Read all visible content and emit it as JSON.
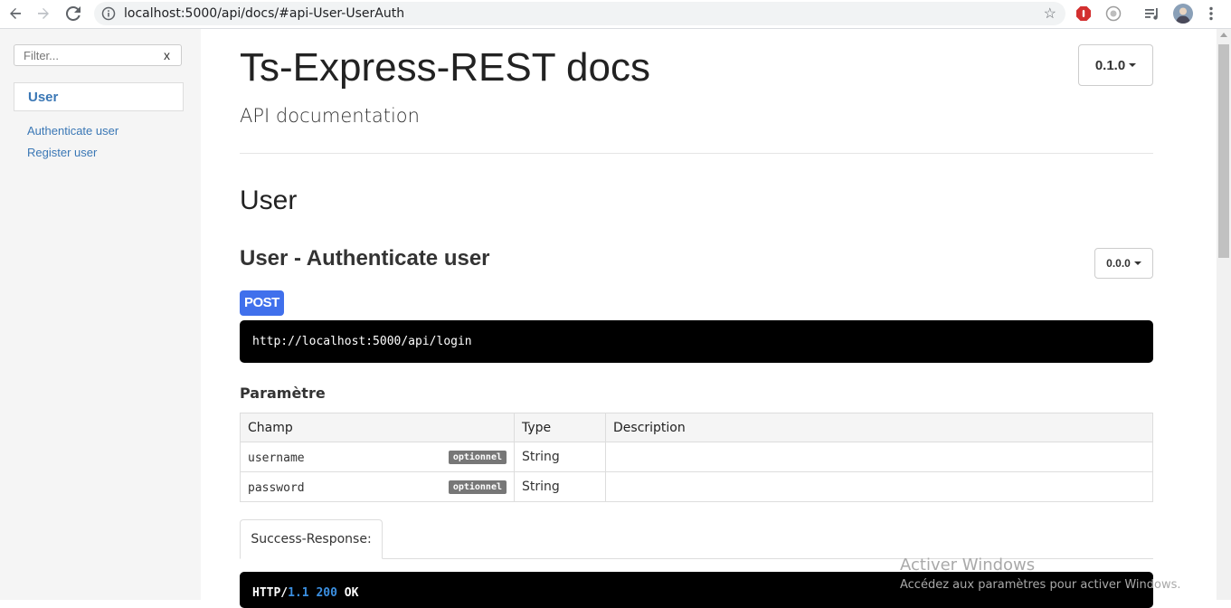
{
  "browser": {
    "url": "localhost:5000/api/docs/#api-User-UserAuth"
  },
  "sidebar": {
    "filter_placeholder": "Filter...",
    "filter_clear": "x",
    "group": "User",
    "links": [
      "Authenticate user",
      "Register user"
    ]
  },
  "header": {
    "title": "Ts-Express-REST docs",
    "subtitle": "API documentation",
    "version": "0.1.0"
  },
  "section": {
    "title": "User"
  },
  "endpoint": {
    "title": "User - Authenticate user",
    "version": "0.0.0",
    "method": "POST",
    "url": "http://localhost:5000/api/login",
    "params_title": "Paramètre",
    "columns": [
      "Champ",
      "Type",
      "Description"
    ],
    "params": [
      {
        "name": "username",
        "badge": "optionnel",
        "type": "String",
        "description": ""
      },
      {
        "name": "password",
        "badge": "optionnel",
        "type": "String",
        "description": ""
      }
    ],
    "tab": "Success-Response:",
    "response": {
      "proto": "HTTP/",
      "version": "1.1",
      "code": "200",
      "status": "OK"
    }
  },
  "watermark": {
    "title": "Activer Windows",
    "subtitle": "Accédez aux paramètres pour activer Windows."
  },
  "colors": {
    "accent": "#3a77b5",
    "post_badge": "#4070ec",
    "code_bg": "#000000",
    "number": "#3b8fe0"
  }
}
